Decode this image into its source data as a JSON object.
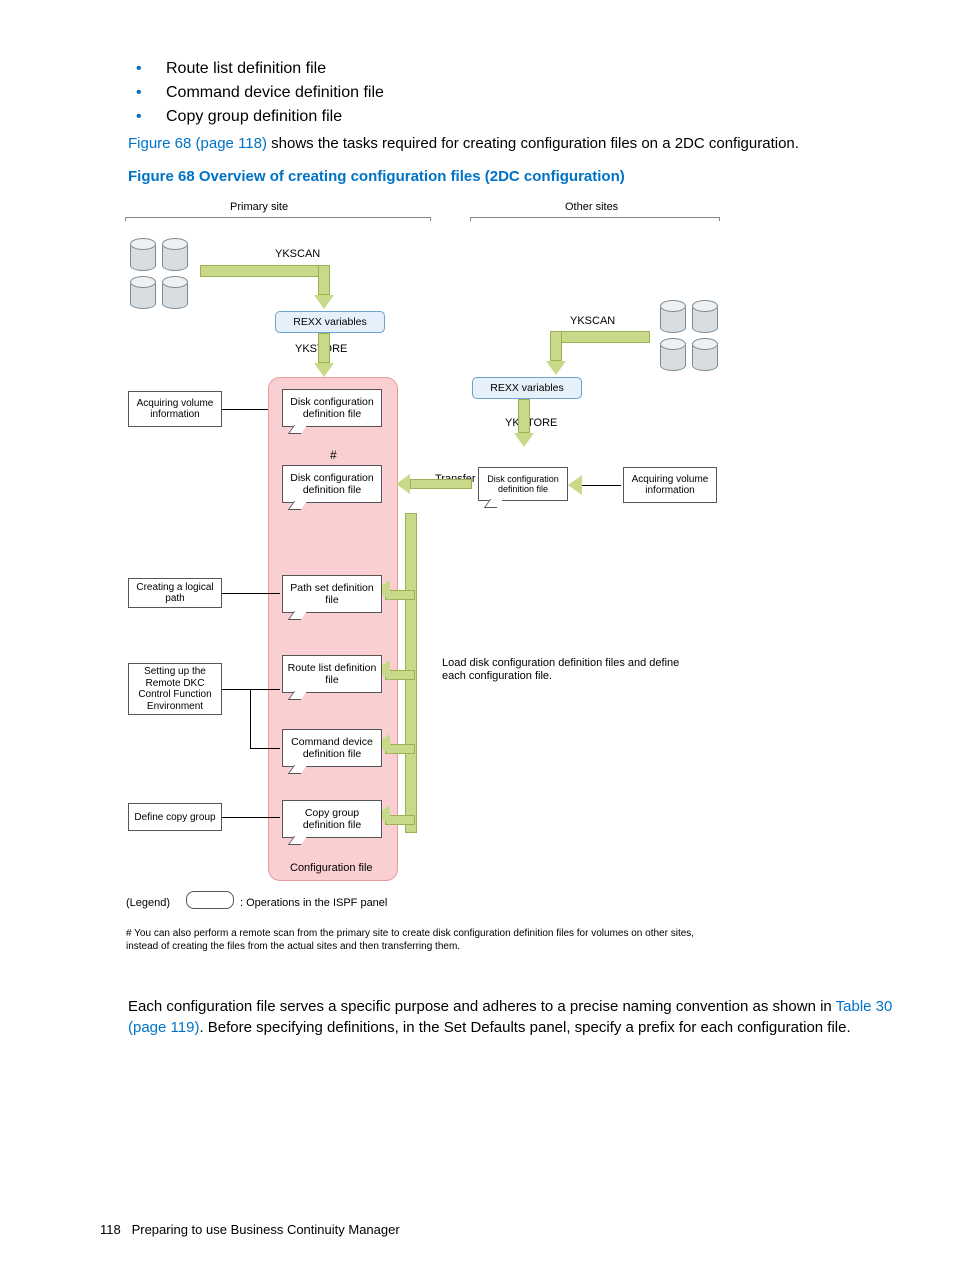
{
  "bullets": [
    "Route list definition file",
    "Command device definition file",
    "Copy group definition file"
  ],
  "intro_p1": "Figure 68 (page 118)",
  "intro_p2": " shows the tasks required for creating configuration files on a 2DC configuration.",
  "figure_title": "Figure 68 Overview of creating configuration files (2DC configuration)",
  "closing_p1": "Each configuration file serves a specific purpose and adheres to a precise naming convention as shown in ",
  "closing_link": "Table 30 (page 119)",
  "closing_p2": ". Before specifying definitions, in the Set Defaults panel, specify a prefix for each configuration file.",
  "page_number": "118",
  "page_footer": "Preparing to use Business Continuity Manager",
  "diagram": {
    "primary_site": "Primary site",
    "other_sites": "Other sites",
    "ykscan": "YKSCAN",
    "ykstore": "YKSTORE",
    "rexx": "REXX variables",
    "acquire": "Acquiring volume information",
    "disk_conf": "Disk configuration definition file",
    "transfer": "Transfer",
    "hash": "#",
    "path_task": "Creating a logical path",
    "pathset": "Path set definition file",
    "remote_task": "Setting up the Remote DKC Control Function Environment",
    "routelist": "Route list definition file",
    "cmddev": "Command device definition file",
    "define_group": "Define copy group",
    "copygroup": "Copy group definition file",
    "config_file": "Configuration file",
    "load_note": "Load disk configuration definition files and define each configuration file.",
    "legend": "(Legend)",
    "legend_text": ": Operations in the ISPF panel",
    "footnote": "# You can also perform a remote scan from the primary site to create disk configuration definition files for volumes on other sites, instead of creating the files from the actual sites and then transferring them."
  }
}
